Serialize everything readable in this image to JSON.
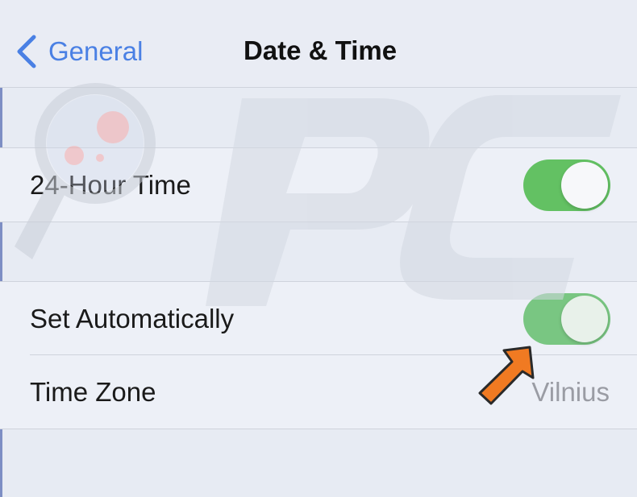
{
  "nav": {
    "back_label": "General",
    "title": "Date & Time",
    "back_icon": "chevron-left-icon"
  },
  "settings": {
    "hour24": {
      "label": "24-Hour Time",
      "enabled": true
    },
    "set_automatically": {
      "label": "Set Automatically",
      "enabled": true
    },
    "time_zone": {
      "label": "Time Zone",
      "value": "Vilnius"
    }
  },
  "colors": {
    "accent": "#4a80e4",
    "toggle_on": "#63c163",
    "background": "#e7ebf3",
    "arrow": "#f07a22"
  },
  "annotation": {
    "icon": "pointer-arrow-icon"
  },
  "watermark": {
    "icon": "pcrisk-magnifier-watermark"
  }
}
